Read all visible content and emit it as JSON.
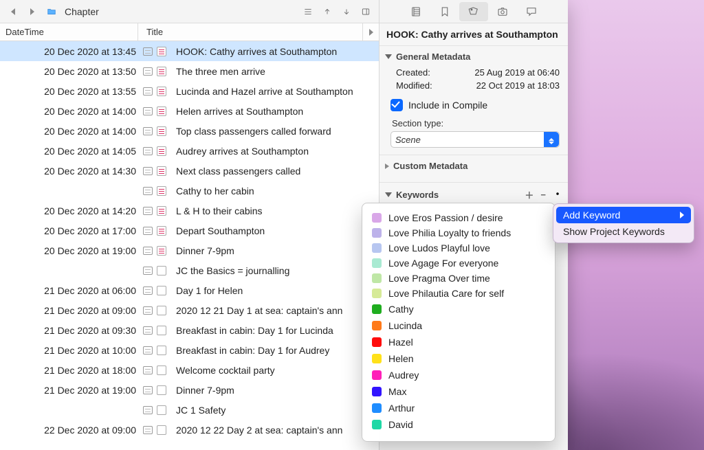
{
  "toolbar": {
    "breadcrumb": "Chapter"
  },
  "columns": {
    "datetime": "DateTime",
    "title": "Title"
  },
  "rows": [
    {
      "dt": "20 Dec 2020 at 13:45",
      "title": "HOOK: Cathy arrives at Southampton",
      "filled": true,
      "selected": true
    },
    {
      "dt": "20 Dec 2020 at 13:50",
      "title": "The three men arrive",
      "filled": true
    },
    {
      "dt": "20 Dec 2020 at 13:55",
      "title": "Lucinda and Hazel arrive at Southampton",
      "filled": true
    },
    {
      "dt": "20 Dec 2020 at 14:00",
      "title": "Helen arrives at Southampton",
      "filled": true
    },
    {
      "dt": "20 Dec 2020 at 14:00",
      "title": "Top class passengers called forward",
      "filled": true
    },
    {
      "dt": "20 Dec 2020 at 14:05",
      "title": "Audrey arrives at Southampton",
      "filled": true
    },
    {
      "dt": "20 Dec 2020 at 14:30",
      "title": "Next class passengers called",
      "filled": true
    },
    {
      "dt": "",
      "title": "Cathy to her cabin",
      "filled": true
    },
    {
      "dt": "20 Dec 2020 at 14:20",
      "title": "L & H to their cabins",
      "filled": true
    },
    {
      "dt": "20 Dec 2020 at 17:00",
      "title": "Depart Southampton",
      "filled": true
    },
    {
      "dt": "20 Dec 2020 at 19:00",
      "title": "Dinner 7-9pm",
      "filled": true
    },
    {
      "dt": "",
      "title": "JC the Basics = journalling",
      "filled": false
    },
    {
      "dt": "21 Dec 2020 at 06:00",
      "title": " Day 1 for Helen",
      "filled": false
    },
    {
      "dt": "21 Dec 2020 at 09:00",
      "title": "2020 12 21 Day 1 at sea: captain's ann",
      "filled": false
    },
    {
      "dt": "21 Dec 2020 at 09:30",
      "title": "Breakfast in cabin: Day 1 for Lucinda",
      "filled": false
    },
    {
      "dt": "21 Dec 2020 at 10:00",
      "title": "Breakfast in cabin: Day 1 for Audrey",
      "filled": false
    },
    {
      "dt": "21 Dec 2020 at 18:00",
      "title": "Welcome cocktail party",
      "filled": false
    },
    {
      "dt": "21 Dec 2020 at 19:00",
      "title": "Dinner 7-9pm",
      "filled": false
    },
    {
      "dt": "",
      "title": "JC 1 Safety",
      "filled": false
    },
    {
      "dt": "22 Dec 2020 at 09:00",
      "title": "2020 12 22 Day 2 at sea: captain's ann",
      "filled": false
    }
  ],
  "inspector": {
    "title": "HOOK: Cathy arrives at Southampton",
    "sections": {
      "general": "General Metadata",
      "custom": "Custom Metadata",
      "keywords": "Keywords"
    },
    "created_k": "Created:",
    "created_v": "25 Aug 2019 at 06:40",
    "modified_k": "Modified:",
    "modified_v": "22 Oct 2019 at 18:03",
    "include_label": "Include in Compile",
    "section_type_label": "Section type:",
    "section_type_value": "Scene"
  },
  "keywords_popover": [
    {
      "color": "#d9a7e8",
      "label": "Love Eros Passion / desire"
    },
    {
      "color": "#bdb2ea",
      "label": "Love Philia Loyalty to friends"
    },
    {
      "color": "#b7c6f0",
      "label": "Love Ludos Playful love"
    },
    {
      "color": "#a9ead2",
      "label": "Love Agage For everyone"
    },
    {
      "color": "#bfe7a6",
      "label": "Love Pragma Over time"
    },
    {
      "color": "#d6ea97",
      "label": "Love Philautia Care for self"
    },
    {
      "color": "#1fad1f",
      "label": "Cathy"
    },
    {
      "color": "#ff7a1a",
      "label": "Lucinda"
    },
    {
      "color": "#ff0d0d",
      "label": "Hazel"
    },
    {
      "color": "#ffe11a",
      "label": "Helen"
    },
    {
      "color": "#ff1fb8",
      "label": "Audrey"
    },
    {
      "color": "#3214ff",
      "label": "Max"
    },
    {
      "color": "#1f8dff",
      "label": "Arthur"
    },
    {
      "color": "#1fd8a5",
      "label": "David"
    }
  ],
  "context_menu": {
    "add_keyword": "Add Keyword",
    "show_project_keywords": "Show Project Keywords"
  }
}
